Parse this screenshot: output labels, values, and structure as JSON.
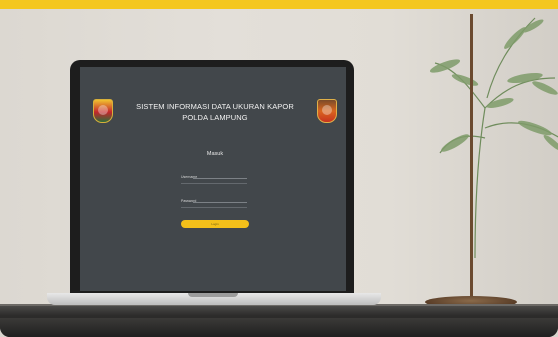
{
  "colors": {
    "accent": "#f4c71f",
    "screen_bg": "#42474b",
    "button": "#f4c01a"
  },
  "app": {
    "title_line1": "SISTEM INFORMASI DATA UKURAN KAPOR",
    "title_line2": "POLDA LAMPUNG"
  },
  "login": {
    "heading": "Masuk",
    "username_label": "Username",
    "password_label": "Password",
    "button_label": "Login"
  },
  "icons": {
    "left_logo": "police-emblem-icon",
    "right_logo": "polda-badge-icon"
  }
}
